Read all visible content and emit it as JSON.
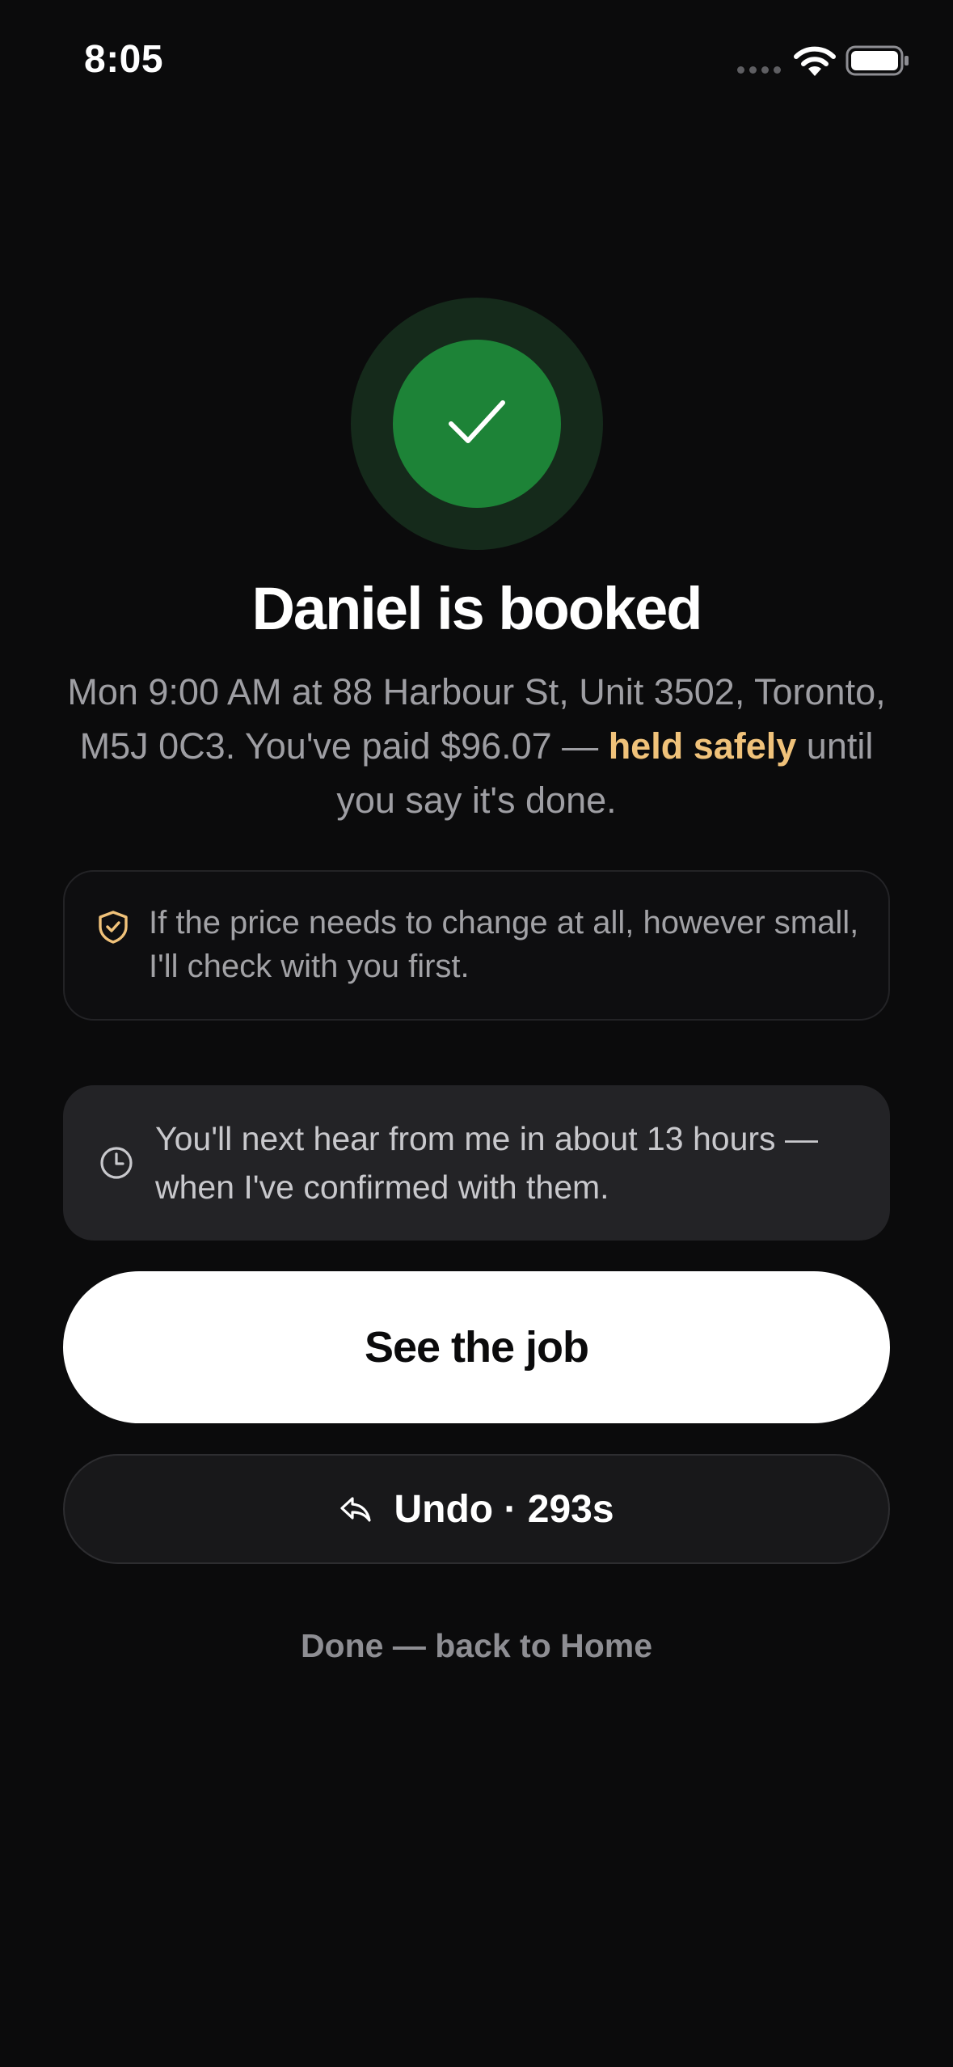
{
  "status_bar": {
    "time": "8:05",
    "icons": [
      "signal-icon",
      "wifi-icon",
      "battery-icon"
    ]
  },
  "success": {
    "icon": "check-icon",
    "colors": {
      "halo": "#152a1b",
      "circle": "#1d8337"
    }
  },
  "title": "Daniel is booked",
  "summary": {
    "text_before": "Mon 9:00 AM at 88 Harbour St, Unit 3502, Toronto, M5J 0C3. You've paid $96.07 — ",
    "highlight": "held safely",
    "text_after": " until you say it's done.",
    "highlight_color": "#f0c27a"
  },
  "price_guard": {
    "icon": "shield-check-icon",
    "text": "If the price needs to change at all, however small, I'll check with you first."
  },
  "next_update": {
    "icon": "clock-icon",
    "text": "You'll next hear from me in about 13 hours — when I've confirmed with them."
  },
  "actions": {
    "primary_label": "See the job",
    "undo_label": "Undo · 293s",
    "undo_icon": "undo-arrow-icon",
    "done_label": "Done — back to Home"
  }
}
